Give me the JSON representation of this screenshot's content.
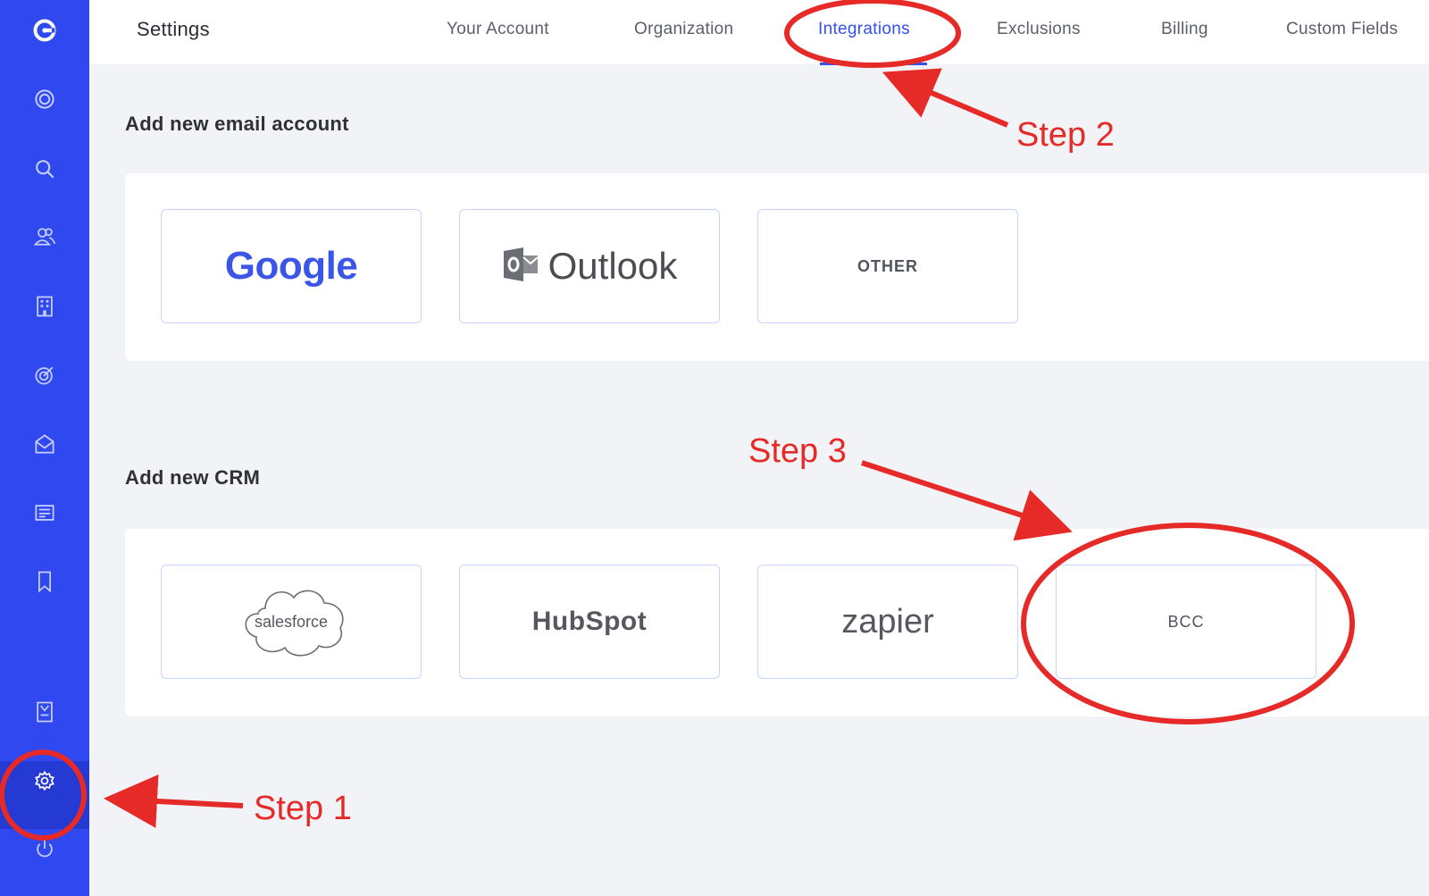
{
  "topbar": {
    "title": "Settings",
    "tabs": [
      {
        "label": "Your Account"
      },
      {
        "label": "Organization"
      },
      {
        "label": "Integrations",
        "active": true
      },
      {
        "label": "Exclusions"
      },
      {
        "label": "Billing"
      },
      {
        "label": "Custom Fields"
      }
    ]
  },
  "sidebar": {
    "icons": [
      "logo-icon",
      "dashboard-icon",
      "search-icon",
      "contacts-icon",
      "companies-icon",
      "target-icon",
      "email-icon",
      "templates-icon",
      "bookmark-icon",
      "reports-icon",
      "gear-icon",
      "power-icon"
    ]
  },
  "email_section": {
    "heading": "Add new email account",
    "cards": [
      {
        "label": "Google"
      },
      {
        "label": "Outlook"
      },
      {
        "label": "OTHER"
      }
    ]
  },
  "crm_section": {
    "heading": "Add new CRM",
    "cards": [
      {
        "label": "salesforce"
      },
      {
        "label": "HubSpot"
      },
      {
        "label": "zapier"
      },
      {
        "label": "BCC"
      }
    ]
  },
  "annotations": {
    "step1": "Step 1",
    "step2": "Step 2",
    "step3": "Step 3",
    "color": "#e52a27"
  },
  "colors": {
    "sidebar": "#2f48f0",
    "accent": "#3350f0"
  }
}
